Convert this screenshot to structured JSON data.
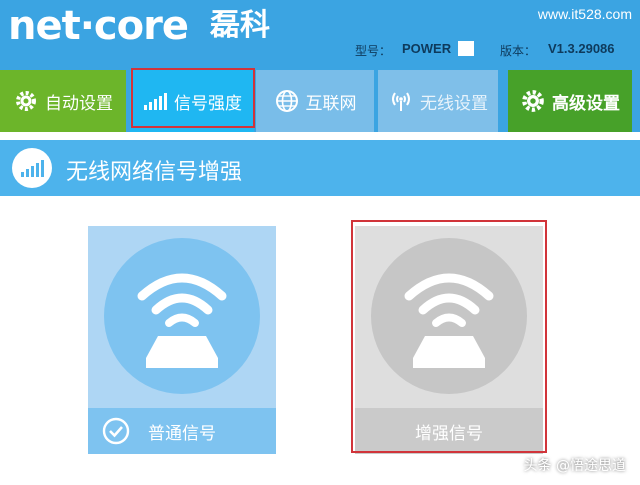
{
  "header": {
    "logo_text": "net·core",
    "logo_cn": "磊科",
    "site_url": "www.it528.com",
    "model_label": "型号：",
    "model_value": "POWER",
    "version_label": "版本：",
    "version_value": "V1.3.29086"
  },
  "nav": {
    "tabs": [
      {
        "label": "自动设置",
        "icon": "gear-icon"
      },
      {
        "label": "信号强度",
        "icon": "signal-bars-icon",
        "highlighted": true
      },
      {
        "label": "互联网",
        "icon": "globe-icon"
      },
      {
        "label": "无线设置",
        "icon": "wireless-antenna-icon"
      },
      {
        "label": "高级设置",
        "icon": "gear-icon"
      }
    ]
  },
  "section": {
    "title": "无线网络信号增强",
    "icon": "signal-bars-icon"
  },
  "cards": [
    {
      "label": "普通信号",
      "icon": "router-wifi-icon",
      "selected": true
    },
    {
      "label": "增强信号",
      "icon": "router-wifi-icon",
      "selected": false
    }
  ],
  "watermark": "头条 @悟途思道",
  "colors": {
    "header_bg": "#3ba4e2",
    "tab_green": "#6cb52a",
    "tab_active": "#1fb7f2",
    "highlight_red": "#d1343a",
    "card_normal": "#aed6f4",
    "card_boost": "#dedede"
  }
}
